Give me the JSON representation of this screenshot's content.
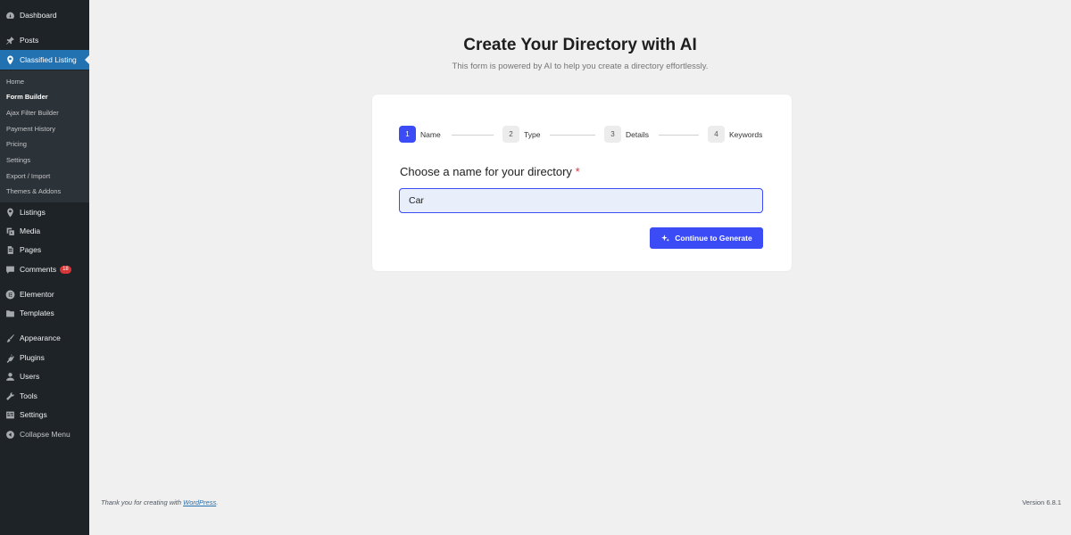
{
  "sidebar": {
    "dashboard": "Dashboard",
    "posts": "Posts",
    "classified_listing": "Classified Listing",
    "submenu": [
      "Home",
      "Form Builder",
      "Ajax Filter Builder",
      "Payment History",
      "Pricing",
      "Settings",
      "Export / Import",
      "Themes & Addons"
    ],
    "listings": "Listings",
    "media": "Media",
    "pages": "Pages",
    "comments": "Comments",
    "comments_count": "18",
    "elementor": "Elementor",
    "templates": "Templates",
    "appearance": "Appearance",
    "plugins": "Plugins",
    "users": "Users",
    "tools": "Tools",
    "settings": "Settings",
    "collapse": "Collapse Menu"
  },
  "main": {
    "title": "Create Your Directory with AI",
    "subtitle": "This form is powered by AI to help you create a directory effortlessly."
  },
  "steps": [
    {
      "num": "1",
      "label": "Name"
    },
    {
      "num": "2",
      "label": "Type"
    },
    {
      "num": "3",
      "label": "Details"
    },
    {
      "num": "4",
      "label": "Keywords"
    }
  ],
  "form": {
    "label": "Choose a name for your directory",
    "required_mark": "*",
    "name_value": "Car",
    "button_label": "Continue to Generate"
  },
  "footer": {
    "thanks_prefix": "Thank you for creating with ",
    "wordpress_link": "WordPress",
    "thanks_suffix": ".",
    "version": "Version 6.8.1"
  },
  "colors": {
    "accent": "#3b4bf5",
    "sidebar_bg": "#1d2327",
    "active_menu": "#2271b1"
  }
}
